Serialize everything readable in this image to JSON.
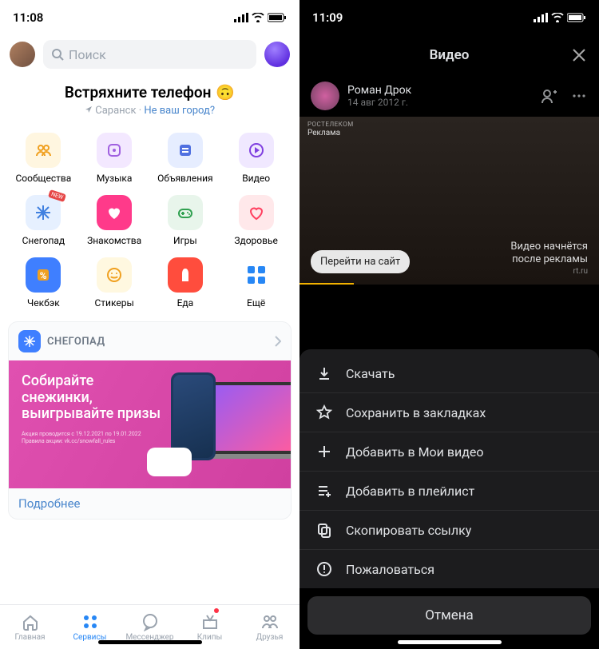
{
  "left": {
    "time": "11:08",
    "search_placeholder": "Поиск",
    "shake_title": "Встряхните телефон",
    "shake_emoji": "🙃",
    "location_city": "Саранск",
    "location_not_yours": "Не ваш город?",
    "services": [
      {
        "label": "Сообщества",
        "icon": "communities-icon"
      },
      {
        "label": "Музыка",
        "icon": "music-icon"
      },
      {
        "label": "Объявления",
        "icon": "ads-icon"
      },
      {
        "label": "Видео",
        "icon": "video-icon"
      },
      {
        "label": "Снегопад",
        "icon": "snowfall-icon"
      },
      {
        "label": "Знакомства",
        "icon": "dating-icon"
      },
      {
        "label": "Игры",
        "icon": "games-icon"
      },
      {
        "label": "Здоровье",
        "icon": "health-icon"
      },
      {
        "label": "Чекбэк",
        "icon": "cashback-icon"
      },
      {
        "label": "Стикеры",
        "icon": "stickers-icon"
      },
      {
        "label": "Еда",
        "icon": "food-icon"
      },
      {
        "label": "Ещё",
        "icon": "more-icon"
      }
    ],
    "banner": {
      "title": "СНЕГОПАД",
      "text": "Собирайте снежинки, выигрывайте призы",
      "fine1": "Акция проводится с 19.12.2021 по 19.01.2022",
      "fine2": "Правила акции: vk.cc/snowfall_rules",
      "more": "Подробнее"
    },
    "tabs": [
      {
        "label": "Главная"
      },
      {
        "label": "Сервисы"
      },
      {
        "label": "Мессенджер"
      },
      {
        "label": "Клипы"
      },
      {
        "label": "Друзья"
      }
    ]
  },
  "right": {
    "time": "11:09",
    "title": "Видео",
    "author_name": "Роман Дрок",
    "author_date": "14 авг 2012 г.",
    "ad_brand": "РОСТЕЛЕКОМ",
    "ad_label": "Реклама",
    "cta": "Перейти на сайт",
    "video_note_line1": "Видео начнётся",
    "video_note_line2": "после рекламы",
    "video_note_sub": "rt.ru",
    "sheet": [
      {
        "label": "Скачать",
        "icon": "download-icon"
      },
      {
        "label": "Сохранить в закладках",
        "icon": "bookmark-star-icon"
      },
      {
        "label": "Добавить в Мои видео",
        "icon": "plus-icon"
      },
      {
        "label": "Добавить в плейлист",
        "icon": "playlist-add-icon"
      },
      {
        "label": "Скопировать ссылку",
        "icon": "copy-icon"
      },
      {
        "label": "Пожаловаться",
        "icon": "report-icon"
      }
    ],
    "cancel": "Отмена"
  }
}
